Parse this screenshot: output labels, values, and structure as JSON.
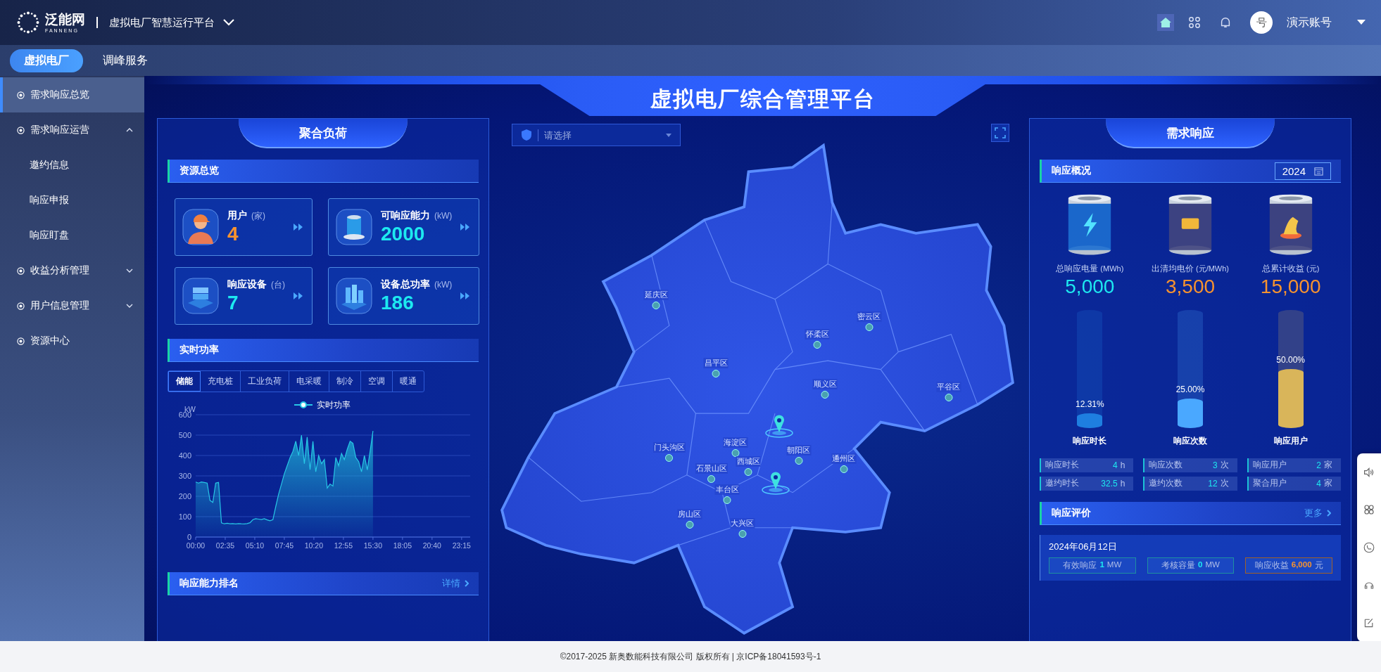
{
  "top_bar": {
    "logo": "泛能网",
    "logo_sub": "FANNENG",
    "platform": "虚拟电厂智慧运行平台",
    "avatar": "号",
    "user": "演示账号"
  },
  "nav_tabs": [
    {
      "label": "虚拟电厂",
      "selected": true
    },
    {
      "label": "调峰服务",
      "selected": false
    }
  ],
  "sidebar": {
    "items": [
      {
        "label": "需求响应总览",
        "selected": true
      },
      {
        "label": "需求响应运营",
        "selected": false,
        "expanded": true,
        "children": [
          {
            "label": "邀约信息",
            "selected": false
          },
          {
            "label": "响应申报",
            "selected": false
          },
          {
            "label": "响应盯盘",
            "selected": false
          }
        ]
      },
      {
        "label": "收益分析管理",
        "selected": false,
        "expanded": false
      },
      {
        "label": "用户信息管理",
        "selected": false,
        "expanded": false
      },
      {
        "label": "资源中心",
        "selected": false
      }
    ]
  },
  "banner": {
    "title": "虚拟电厂综合管理平台"
  },
  "left_panel": {
    "title": "聚合负荷",
    "resource_header": "资源总览",
    "cards": [
      {
        "kind": "users",
        "label": "用户",
        "unit": "(家)",
        "value": "4",
        "color": "#f7932f"
      },
      {
        "kind": "capacity",
        "label": "可响应能力",
        "unit": "(kW)",
        "value": "2000",
        "color": "#1de9f0"
      },
      {
        "kind": "devices",
        "label": "响应设备",
        "unit": "(台)",
        "value": "7",
        "color": "#1de9f0"
      },
      {
        "kind": "power",
        "label": "设备总功率",
        "unit": "(kW)",
        "value": "186",
        "color": "#1de9f0"
      }
    ],
    "power_header": "实时功率",
    "tabs": [
      {
        "label": "储能",
        "selected": true
      },
      {
        "label": "充电桩",
        "selected": false
      },
      {
        "label": "工业负荷",
        "selected": false
      },
      {
        "label": "电采暖",
        "selected": false
      },
      {
        "label": "制冷",
        "selected": false
      },
      {
        "label": "空调",
        "selected": false
      },
      {
        "label": "暖通",
        "selected": false
      }
    ],
    "chart_data": {
      "type": "area",
      "grid": true,
      "ylabel": "kW",
      "xlim": [
        0,
        1440
      ],
      "ylim": [
        0,
        600
      ],
      "yticks": [
        0,
        100,
        200,
        300,
        400,
        500,
        600
      ],
      "xticks": [
        {
          "value": 0,
          "label": "00:00"
        },
        {
          "value": 155,
          "label": "02:35"
        },
        {
          "value": 310,
          "label": "05:10"
        },
        {
          "value": 465,
          "label": "07:45"
        },
        {
          "value": 620,
          "label": "10:20"
        },
        {
          "value": 775,
          "label": "12:55"
        },
        {
          "value": 930,
          "label": "15:30"
        },
        {
          "value": 1085,
          "label": "18:05"
        },
        {
          "value": 1240,
          "label": "20:40"
        },
        {
          "value": 1395,
          "label": "23:15"
        }
      ],
      "x": [
        0,
        15,
        30,
        45,
        60,
        75,
        90,
        105,
        120,
        135,
        150,
        165,
        180,
        195,
        210,
        225,
        240,
        255,
        270,
        285,
        300,
        315,
        330,
        345,
        360,
        375,
        390,
        405,
        420,
        435,
        450,
        465,
        480,
        495,
        510,
        525,
        540,
        555,
        570,
        585,
        600,
        615,
        630,
        645,
        660,
        675,
        690,
        705,
        720,
        735,
        750,
        765,
        780,
        795,
        810,
        825,
        840,
        855,
        870,
        885,
        900,
        915,
        930
      ],
      "series": [
        {
          "name": "实时功率",
          "color": "#27c6e6",
          "values": [
            270,
            265,
            270,
            268,
            265,
            180,
            170,
            265,
            268,
            70,
            65,
            68,
            65,
            66,
            64,
            66,
            65,
            64,
            66,
            70,
            85,
            90,
            88,
            86,
            90,
            84,
            80,
            85,
            150,
            210,
            260,
            310,
            350,
            390,
            420,
            470,
            400,
            500,
            360,
            490,
            330,
            470,
            320,
            400,
            360,
            380,
            240,
            260,
            250,
            390,
            350,
            410,
            380,
            430,
            470,
            460,
            390,
            370,
            320,
            400,
            330,
            420,
            520
          ]
        }
      ]
    },
    "ranking_header": "响应能力排名",
    "ranking_link": "详情"
  },
  "map": {
    "select_placeholder": "请选择",
    "districts": [
      "延庆区",
      "密云区",
      "怀柔区",
      "昌平区",
      "顺义区",
      "平谷区",
      "门头沟区",
      "海淀区",
      "石景山区",
      "西城区",
      "朝阳区",
      "丰台区",
      "通州区",
      "房山区",
      "大兴区"
    ]
  },
  "right_panel": {
    "title": "需求响应",
    "overview_header": "响应概况",
    "year": "2024",
    "totals": [
      {
        "kind": "energy",
        "label": "总响应电量",
        "unit": "(MWh)",
        "value": "5,000",
        "color": "#1de9f0"
      },
      {
        "kind": "price",
        "label": "出清均电价",
        "unit": "(元/MWh)",
        "value": "3,500",
        "color": "#f7932f"
      },
      {
        "kind": "income",
        "label": "总累计收益",
        "unit": "(元)",
        "value": "15,000",
        "color": "#f7932f"
      }
    ],
    "gauges": [
      {
        "label": "响应时长",
        "reading": "12.31%",
        "level": 0.1231,
        "color": "#1e7fe0"
      },
      {
        "label": "响应次数",
        "reading": "25.00%",
        "level": 0.25,
        "color": "#4aa8ff"
      },
      {
        "label": "响应用户",
        "reading": "50.00%",
        "level": 0.5,
        "color": "#d9b55a"
      }
    ],
    "stats": [
      {
        "label": "响应时长",
        "value": "4",
        "unit": "h"
      },
      {
        "label": "响应次数",
        "value": "3",
        "unit": "次"
      },
      {
        "label": "响应用户",
        "value": "2",
        "unit": "家"
      },
      {
        "label": "邀约时长",
        "value": "32.5",
        "unit": "h"
      },
      {
        "label": "邀约次数",
        "value": "12",
        "unit": "次"
      },
      {
        "label": "聚合用户",
        "value": "4",
        "unit": "家"
      }
    ],
    "evaluation_header": "响应评价",
    "more_link": "更多",
    "evaluation": {
      "date": "2024年06月12日",
      "chips": [
        {
          "kind": "normal",
          "label": "有效响应",
          "value": "1",
          "unit": "MW"
        },
        {
          "kind": "normal",
          "label": "考核容量",
          "value": "0",
          "unit": "MW"
        },
        {
          "kind": "income",
          "label": "响应收益",
          "value": "6,000",
          "unit": "元"
        }
      ]
    }
  },
  "footer": "©2017-2025 新奥数能科技有限公司 版权所有 | 京ICP备18041593号-1"
}
